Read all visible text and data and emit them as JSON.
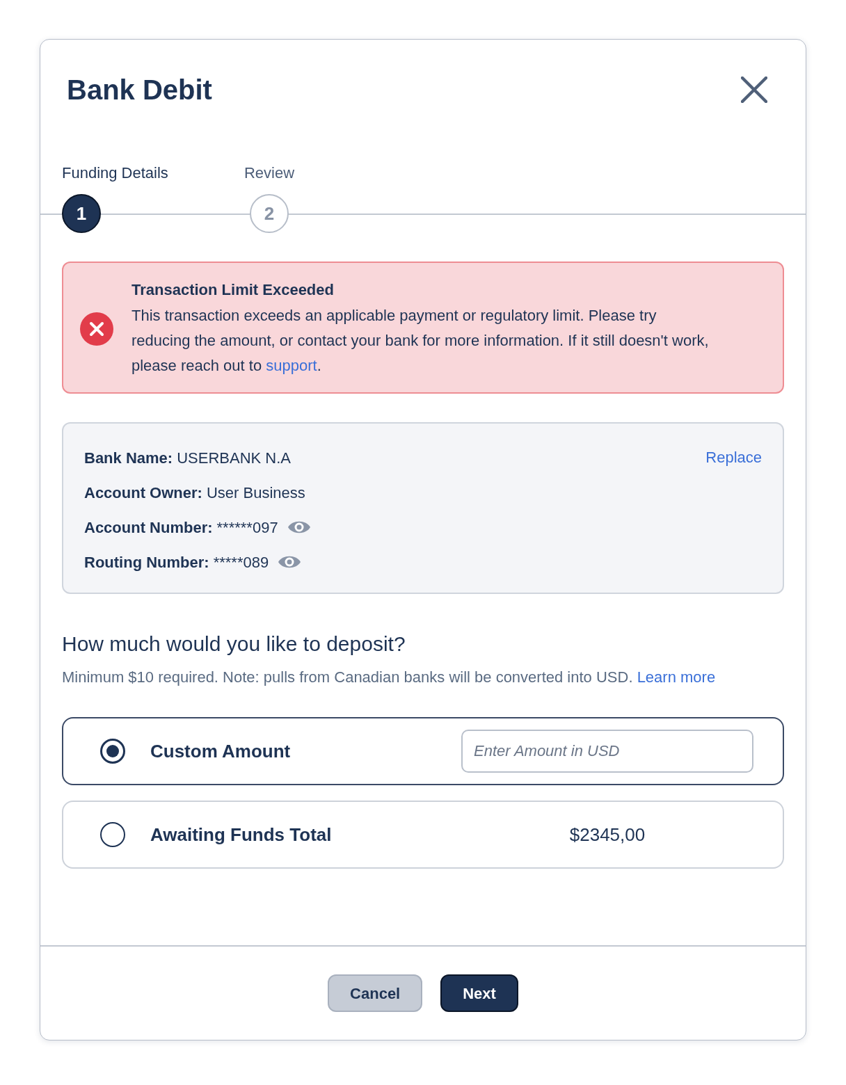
{
  "dialog": {
    "title": "Bank Debit"
  },
  "stepper": {
    "steps": [
      {
        "label": "Funding Details",
        "number": "1",
        "selected": true
      },
      {
        "label": "Review",
        "number": "2",
        "selected": false
      }
    ]
  },
  "alert": {
    "kind": "error",
    "title": "Transaction Limit Exceeded",
    "message": "This transaction exceeds an applicable payment or regulatory limit. Please try reducing the amount, or contact your bank for more information. If it still doesn't work, please reach out to",
    "link": "support",
    "trailing": "."
  },
  "bank_details": {
    "action": "Replace",
    "fields": [
      {
        "label": "Bank Name:",
        "value": "USERBANK N.A",
        "revealable": false
      },
      {
        "label": "Account Owner:",
        "value": "User Business",
        "revealable": false
      },
      {
        "label": "Account Number:",
        "value": "******097",
        "revealable": true
      },
      {
        "label": "Routing Number:",
        "value": "*****089",
        "revealable": true
      }
    ]
  },
  "deposit": {
    "heading": "How much would you like to deposit?",
    "note": "Minimum $10 required. Note: pulls from Canadian banks will be converted into USD.",
    "link": "Learn more",
    "options": [
      {
        "kind": "input",
        "label": "Custom Amount",
        "selected": true,
        "placeholder": "Enter Amount in USD"
      },
      {
        "kind": "amount",
        "label": "Awaiting Funds Total",
        "selected": false,
        "value": "$2345,00"
      }
    ]
  },
  "footer": {
    "buttons": [
      {
        "label": "Cancel",
        "kind": "secondary"
      },
      {
        "label": "Next",
        "kind": "primary"
      }
    ]
  }
}
